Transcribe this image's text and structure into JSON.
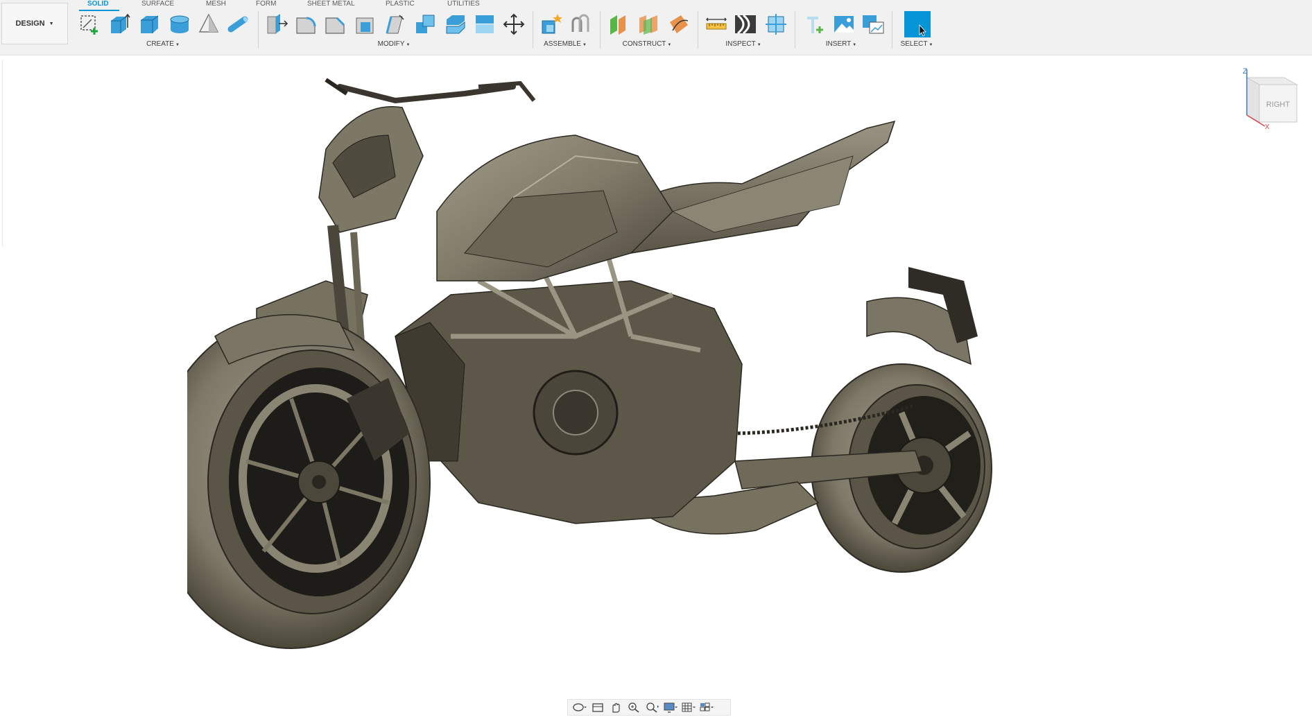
{
  "workspace": {
    "label": "DESIGN"
  },
  "tabs": [
    {
      "label": "SOLID",
      "active": true
    },
    {
      "label": "SURFACE"
    },
    {
      "label": "MESH"
    },
    {
      "label": "FORM"
    },
    {
      "label": "SHEET METAL"
    },
    {
      "label": "PLASTIC"
    },
    {
      "label": "UTILITIES"
    }
  ],
  "groups": {
    "create": {
      "label": "CREATE",
      "tools": [
        "create-sketch-icon",
        "extrude-icon",
        "box-icon",
        "cylinder-icon",
        "cone-icon",
        "pipe-icon"
      ]
    },
    "modify": {
      "label": "MODIFY",
      "tools": [
        "press-pull-icon",
        "fillet-icon",
        "chamfer-icon",
        "shell-icon",
        "draft-icon",
        "combine-icon",
        "split-body-icon",
        "split-face-icon",
        "move-copy-icon"
      ]
    },
    "assemble": {
      "label": "ASSEMBLE",
      "tools": [
        "new-component-icon",
        "joint-icon"
      ]
    },
    "construct": {
      "label": "CONSTRUCT",
      "tools": [
        "offset-plane-icon",
        "midplane-icon",
        "plane-along-path-icon"
      ]
    },
    "inspect": {
      "label": "INSPECT",
      "tools": [
        "measure-icon",
        "zebra-analysis-icon",
        "section-analysis-icon"
      ]
    },
    "insert": {
      "label": "INSERT",
      "tools": [
        "insert-derive-icon",
        "decal-icon",
        "canvas-icon"
      ]
    },
    "select": {
      "label": "SELECT",
      "tools": [
        "select-cursor-icon"
      ]
    }
  },
  "viewcube": {
    "face": "RIGHT",
    "axis_z": "Z",
    "axis_x": "X"
  },
  "colors": {
    "accent": "#0696d7",
    "body": "#8d8879",
    "body_dark": "#3d3a33",
    "toolbar_bg": "#f1f1f1"
  },
  "navbar": [
    "orbit-icon",
    "look-at-icon",
    "pan-icon",
    "zoom-icon",
    "fit-icon",
    "display-settings-icon",
    "grid-settings-icon",
    "viewports-icon"
  ]
}
